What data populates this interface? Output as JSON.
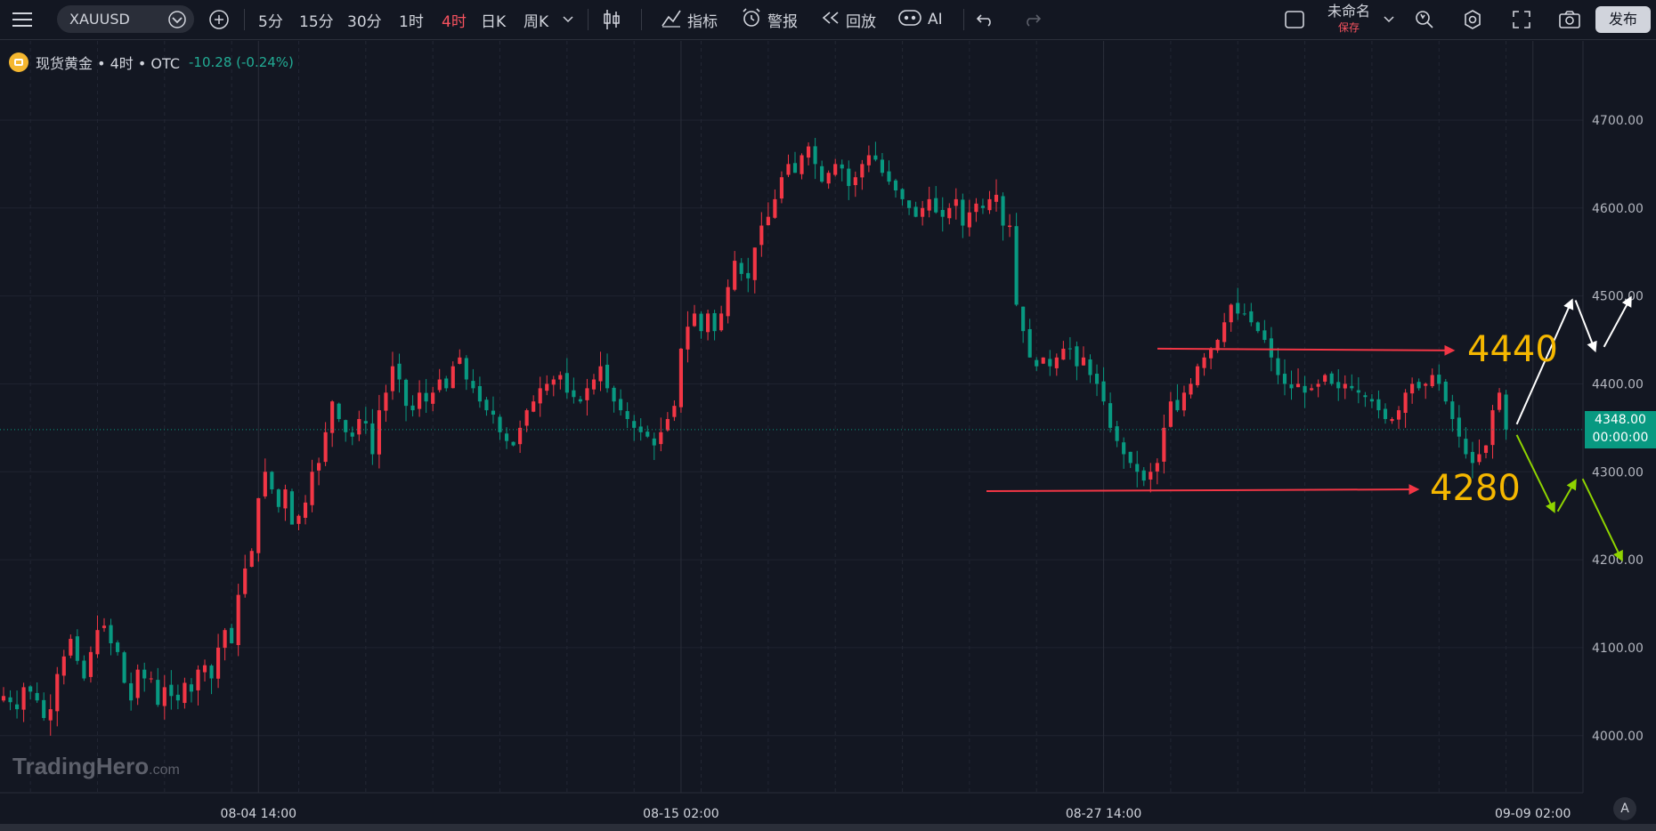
{
  "toolbar": {
    "menu_icon": "hamburger-icon",
    "symbol": "XAUUSD",
    "intervals": [
      "5分",
      "15分",
      "30分",
      "1时",
      "4时",
      "日K",
      "周K"
    ],
    "active_interval": "4时",
    "indicators_label": "指标",
    "alert_label": "警报",
    "replay_label": "回放",
    "ai_label": "AI",
    "layout_name": "未命名",
    "save_label": "保存",
    "publish_label": "发布"
  },
  "legend": {
    "title": "现货黄金 • 4时 • OTC",
    "change": "-10.28 (-0.24%)"
  },
  "price_tag": {
    "price": "4348.00",
    "countdown": "00:00:00"
  },
  "watermark": {
    "brand": "TradingHero",
    "suffix": ".com"
  },
  "auto_label": "A",
  "colors": {
    "up": "#f23645",
    "down": "#089981",
    "bg": "#131722",
    "annotation": "#f5b700",
    "green_arrow": "#8fd400"
  },
  "chart_data": {
    "type": "candlestick",
    "symbol": "XAUUSD",
    "ylim": [
      3935,
      4790
    ],
    "y_ticks": [
      4000,
      4100,
      4200,
      4300,
      4400,
      4500,
      4600,
      4700
    ],
    "y_tick_labels": [
      "4000.00",
      "4100.00",
      "4200.00",
      "4300.00",
      "4400.00",
      "4500.00",
      "4600.00",
      "4700.00"
    ],
    "x_tick_labels": [
      {
        "label": "08-04 14:00",
        "index": 38
      },
      {
        "label": "08-15 02:00",
        "index": 101
      },
      {
        "label": "08-27 14:00",
        "index": 164
      },
      {
        "label": "09-09 02:00",
        "index": 228
      }
    ],
    "last_price": 4348,
    "trend_close": [
      4045,
      4038,
      4030,
      4055,
      4050,
      4040,
      4020,
      4030,
      4070,
      4090,
      4110,
      4085,
      4065,
      4095,
      4120,
      4125,
      4105,
      4095,
      4060,
      4040,
      4075,
      4065,
      4065,
      4035,
      4055,
      4045,
      4040,
      4060,
      4050,
      4075,
      4080,
      4065,
      4100,
      4120,
      4105,
      4160,
      4190,
      4210,
      4270,
      4300,
      4280,
      4260,
      4280,
      4240,
      4250,
      4265,
      4300,
      4310,
      4345,
      4380,
      4360,
      4345,
      4340,
      4360,
      4355,
      4320,
      4370,
      4390,
      4420,
      4405,
      4375,
      4370,
      4390,
      4380,
      4390,
      4405,
      4395,
      4420,
      4430,
      4405,
      4395,
      4380,
      4370,
      4365,
      4345,
      4335,
      4330,
      4350,
      4370,
      4380,
      4395,
      4400,
      4405,
      4410,
      4390,
      4385,
      4380,
      4395,
      4405,
      4420,
      4395,
      4380,
      4370,
      4360,
      4350,
      4345,
      4340,
      4330,
      4345,
      4360,
      4375,
      4440,
      4465,
      4480,
      4460,
      4480,
      4460,
      4480,
      4510,
      4540,
      4525,
      4520,
      4555,
      4580,
      4590,
      4610,
      4635,
      4650,
      4640,
      4660,
      4670,
      4650,
      4630,
      4640,
      4650,
      4645,
      4625,
      4635,
      4650,
      4660,
      4655,
      4640,
      4630,
      4620,
      4610,
      4600,
      4590,
      4600,
      4610,
      4595,
      4590,
      4600,
      4610,
      4580,
      4595,
      4605,
      4600,
      4610,
      4615,
      4580,
      4580,
      4490,
      4460,
      4430,
      4420,
      4430,
      4420,
      4430,
      4440,
      4440,
      4420,
      4430,
      4410,
      4400,
      4380,
      4350,
      4335,
      4320,
      4310,
      4300,
      4290,
      4300,
      4310,
      4350,
      4380,
      4370,
      4390,
      4400,
      4420,
      4430,
      4440,
      4450,
      4470,
      4490,
      4480,
      4480,
      4470,
      4460,
      4450,
      4430,
      4410,
      4400,
      4395,
      4400,
      4390,
      4395,
      4400,
      4410,
      4400,
      4395,
      4400,
      4395,
      4390,
      4385,
      4380,
      4370,
      4360,
      4360,
      4370,
      4390,
      4400,
      4395,
      4400,
      4410,
      4400,
      4380,
      4360,
      4340,
      4320,
      4310,
      4320,
      4330,
      4370,
      4390,
      4348
    ]
  }
}
